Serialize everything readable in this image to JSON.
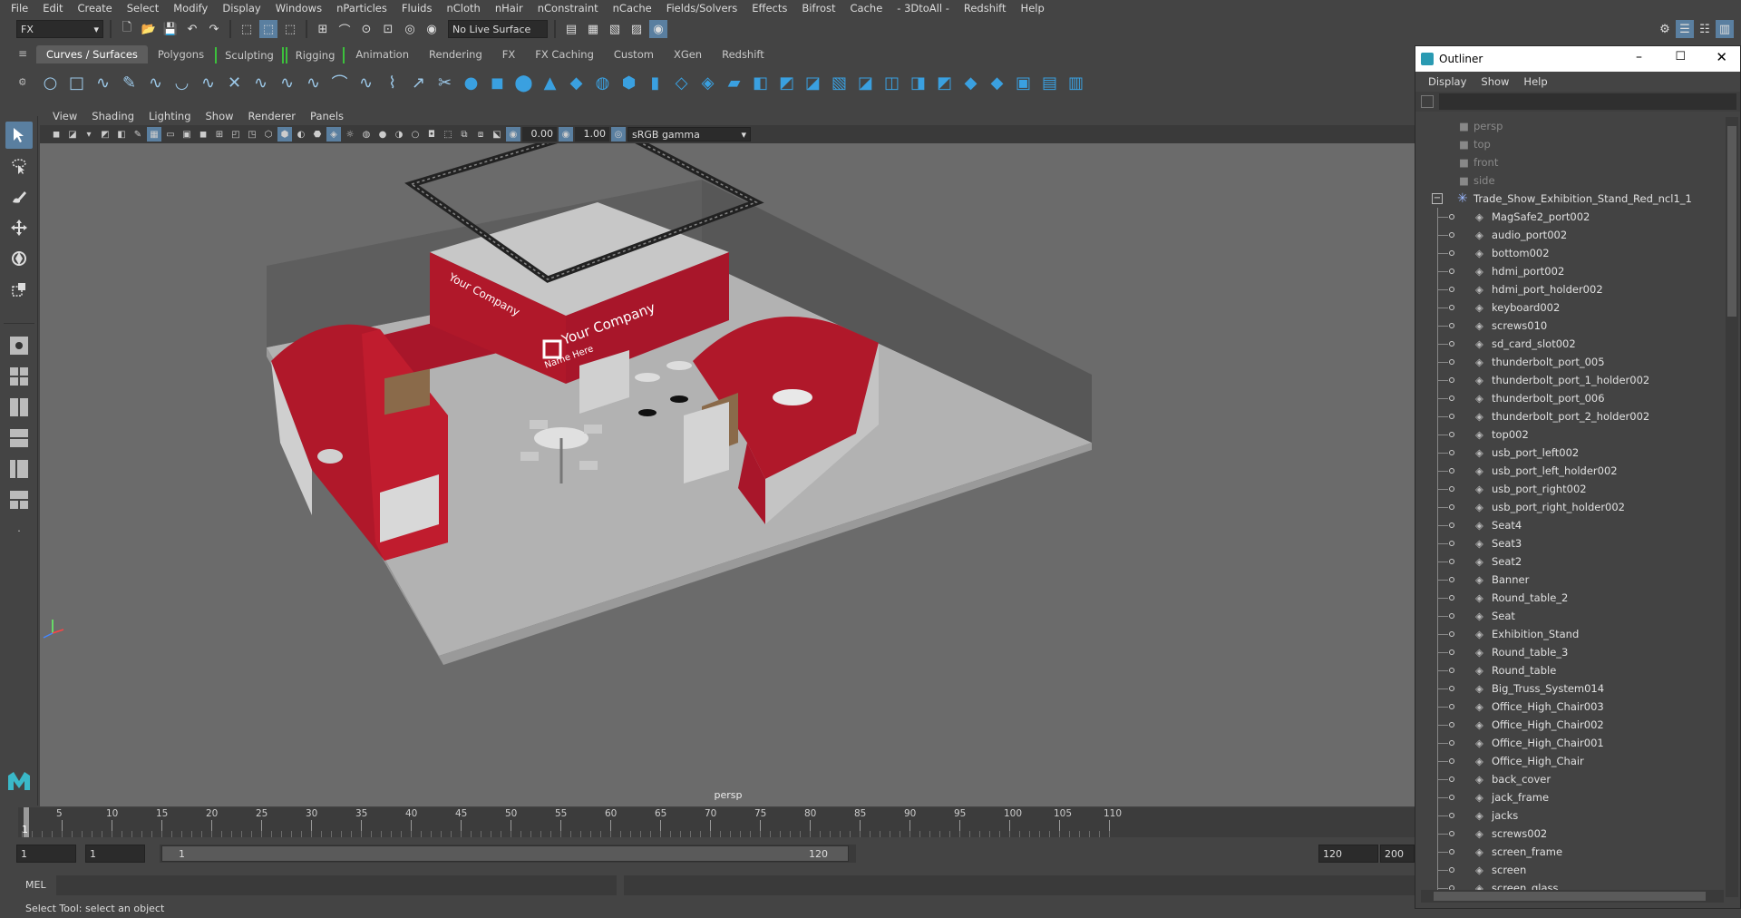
{
  "menubar": [
    "File",
    "Edit",
    "Create",
    "Select",
    "Modify",
    "Display",
    "Windows",
    "nParticles",
    "Fluids",
    "nCloth",
    "nHair",
    "nConstraint",
    "nCache",
    "Fields/Solvers",
    "Effects",
    "Bifrost",
    "Cache",
    "- 3DtoAll -",
    "Redshift",
    "Help"
  ],
  "status": {
    "mode": "FX",
    "live_surface": "No Live Surface"
  },
  "shelf_tabs": [
    {
      "label": "Curves / Surfaces",
      "active": true
    },
    {
      "label": "Polygons"
    },
    {
      "label": "Sculpting",
      "bracket": true
    },
    {
      "label": "Rigging",
      "bracket": true
    },
    {
      "label": "Animation"
    },
    {
      "label": "Rendering"
    },
    {
      "label": "FX"
    },
    {
      "label": "FX Caching"
    },
    {
      "label": "Custom"
    },
    {
      "label": "XGen"
    },
    {
      "label": "Redshift"
    }
  ],
  "viewport": {
    "menu": [
      "View",
      "Shading",
      "Lighting",
      "Show",
      "Renderer",
      "Panels"
    ],
    "exposure": "0.00",
    "gamma": "1.00",
    "color_space": "sRGB gamma",
    "camera_label": "persp",
    "banner_text": "Your Company",
    "banner_sub": "Name Here"
  },
  "timeline": {
    "ticks": [
      "5",
      "10",
      "15",
      "20",
      "25",
      "30",
      "35",
      "40",
      "45",
      "50",
      "55",
      "60",
      "65",
      "70",
      "75",
      "80",
      "85",
      "90",
      "95",
      "100",
      "105",
      "110"
    ],
    "current_frame": "1"
  },
  "range": {
    "start": "1",
    "playback_start": "1",
    "slider_start": "1",
    "slider_end": "120",
    "playback_end": "120",
    "end": "200"
  },
  "cmdline": {
    "label": "MEL"
  },
  "helpline": {
    "text": "Select Tool: select an object"
  },
  "outliner": {
    "title": "Outliner",
    "menu": [
      "Display",
      "Show",
      "Help"
    ],
    "cameras": [
      "persp",
      "top",
      "front",
      "side"
    ],
    "root": "Trade_Show_Exhibition_Stand_Red_ncl1_1",
    "items": [
      "MagSafe2_port002",
      "audio_port002",
      "bottom002",
      "hdmi_port002",
      "hdmi_port_holder002",
      "keyboard002",
      "screws010",
      "sd_card_slot002",
      "thunderbolt_port_005",
      "thunderbolt_port_1_holder002",
      "thunderbolt_port_006",
      "thunderbolt_port_2_holder002",
      "top002",
      "usb_port_left002",
      "usb_port_left_holder002",
      "usb_port_right002",
      "usb_port_right_holder002",
      "Seat4",
      "Seat3",
      "Seat2",
      "Banner",
      "Round_table_2",
      "Seat",
      "Exhibition_Stand",
      "Round_table_3",
      "Round_table",
      "Big_Truss_System014",
      "Office_High_Chair003",
      "Office_High_Chair002",
      "Office_High_Chair001",
      "Office_High_Chair",
      "back_cover",
      "jack_frame",
      "jacks",
      "screws002",
      "screen_frame",
      "screen",
      "screen_glass"
    ]
  },
  "colors": {
    "accent": "#5a7fa0",
    "brand_red": "#b0182a",
    "bracket_green": "#3cc03c"
  }
}
